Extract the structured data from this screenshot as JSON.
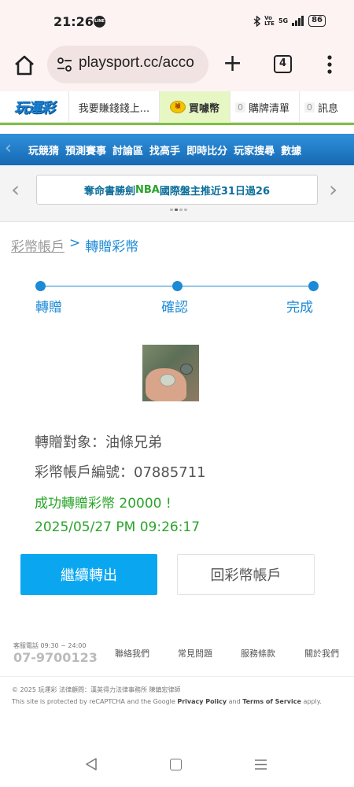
{
  "status_bar": {
    "time": "21:26",
    "app_icon": "line-icon",
    "network": "5G",
    "battery": "86"
  },
  "browser": {
    "url": "playsport.cc/acco",
    "tab_count": "4"
  },
  "site_topbar": {
    "logo": "玩運彩",
    "earn_label": "我要賺錢錢上...",
    "coin_label": "買噱幣",
    "cart_count": "0",
    "cart_label": "購牌清單",
    "msg_count": "0",
    "msg_label": "訊息"
  },
  "main_nav": {
    "items": [
      "玩競猜",
      "預測賽事",
      "討論區",
      "找高手",
      "即時比分",
      "玩家搜尋",
      "數據"
    ]
  },
  "marquee": {
    "text_prefix": "奪命書勝劍 ",
    "text_highlight": "NBA",
    "text_suffix": " 國際盤主推近31日過26"
  },
  "breadcrumb": {
    "parent": "彩幣帳戶",
    "separator": ">",
    "current": "轉贈彩幣"
  },
  "stepper": {
    "steps": [
      "轉贈",
      "確認",
      "完成"
    ],
    "color": "#1d8ad6"
  },
  "transfer": {
    "recipient": "轉贈對象：油條兄弟",
    "account": "彩幣帳戶編號：07885711",
    "success": "成功轉贈彩幣 20000 !",
    "timestamp": "2025/05/27 PM 09:26:17"
  },
  "actions": {
    "continue_label": "繼續轉出",
    "back_label": "回彩幣帳戶"
  },
  "footer": {
    "hotline_label": "客服電話 09:30 ~ 24:00",
    "hotline_number": "07-9700123",
    "links": [
      "聯絡我們",
      "常見問題",
      "服務條款",
      "關於我們"
    ],
    "copyright": "© 2025 玩運彩 法律顧問：漢英得力法律事務所 陳鎮宏律師",
    "recaptcha_prefix": "This site is protected by reCAPTCHA and the Google ",
    "privacy": "Privacy Policy",
    "and": " and ",
    "terms": "Terms of Service",
    "suffix": " apply."
  },
  "colors": {
    "accent_blue": "#1d8ad6",
    "button_blue": "#0aa7f0",
    "success_green": "#2aa42a"
  }
}
